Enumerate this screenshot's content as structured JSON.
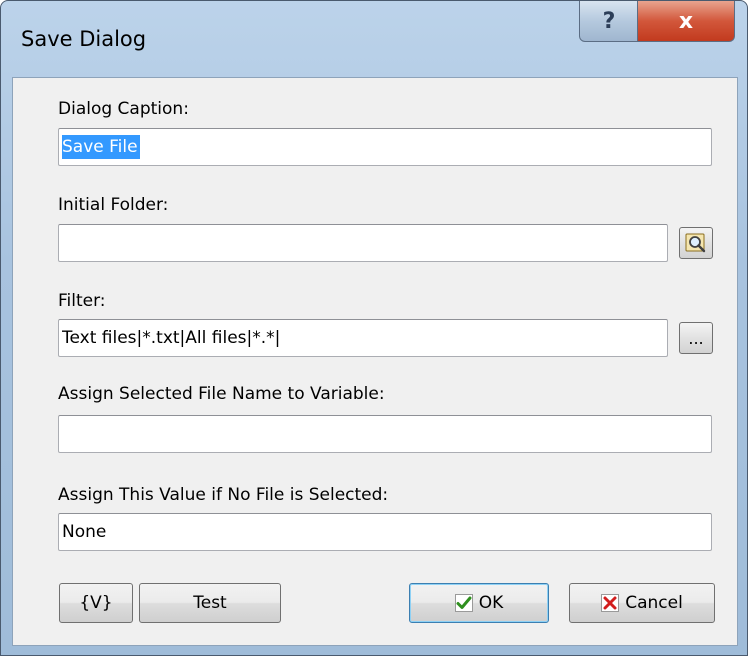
{
  "window": {
    "title": "Save Dialog",
    "help_glyph": "?",
    "close_glyph": "x"
  },
  "fields": {
    "dialog_caption": {
      "label": "Dialog Caption:",
      "value": "Save File"
    },
    "initial_folder": {
      "label": "Initial Folder:",
      "value": ""
    },
    "filter": {
      "label": "Filter:",
      "value": "Text files|*.txt|All files|*.*|"
    },
    "assign_variable": {
      "label": "Assign Selected File Name to Variable:",
      "value": ""
    },
    "default_value": {
      "label": "Assign This Value if No File is Selected:",
      "value": "None"
    }
  },
  "buttons": {
    "browse_icon": "folder-search-icon",
    "filter_edit": "...",
    "variables": "{V}",
    "test": "Test",
    "ok": "OK",
    "cancel": "Cancel"
  },
  "colors": {
    "ok_check": "#2f8f1f",
    "cancel_x": "#d21e1e",
    "selection": "#3399ff"
  }
}
